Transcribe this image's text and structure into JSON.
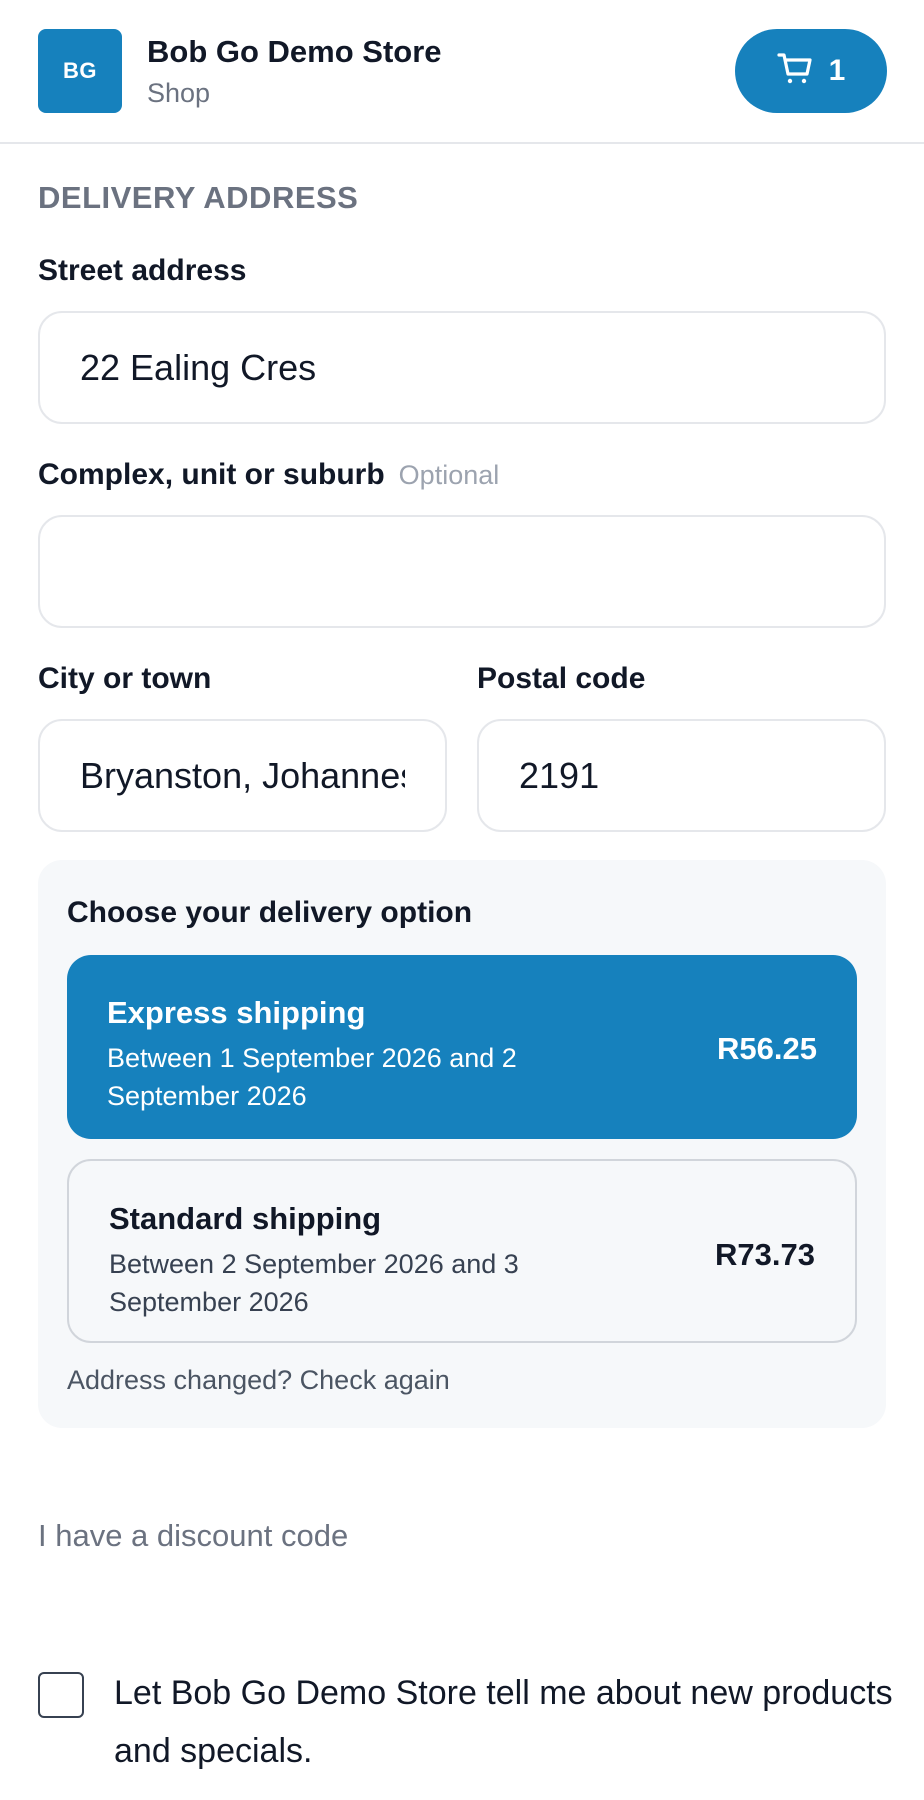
{
  "header": {
    "logo_text": "BG",
    "store_name": "Bob Go Demo Store",
    "store_subtitle": "Shop",
    "cart_icon": "cart-icon",
    "cart_count": "1",
    "accent_color": "#1681bd"
  },
  "delivery_address": {
    "section_title": "DELIVERY ADDRESS",
    "street": {
      "label": "Street address",
      "value": "22 Ealing Cres"
    },
    "complex": {
      "label": "Complex, unit or suburb",
      "optional": "Optional",
      "value": ""
    },
    "city": {
      "label": "City or town",
      "value": "Bryanston, Johannesburg"
    },
    "postal": {
      "label": "Postal code",
      "value": "2191"
    }
  },
  "delivery_options": {
    "title": "Choose your delivery option",
    "options": [
      {
        "name": "Express shipping",
        "description": "Between 1 September 2026 and 2 September 2026",
        "price": "R56.25",
        "selected": true
      },
      {
        "name": "Standard shipping",
        "description": "Between 2 September 2026 and 3 September 2026",
        "price": "R73.73",
        "selected": false
      }
    ],
    "check_again": "Address changed? Check again"
  },
  "discount_link": "I have a discount code",
  "marketing_consent": {
    "label": "Let Bob Go Demo Store tell me about new products and specials.",
    "checked": false
  }
}
